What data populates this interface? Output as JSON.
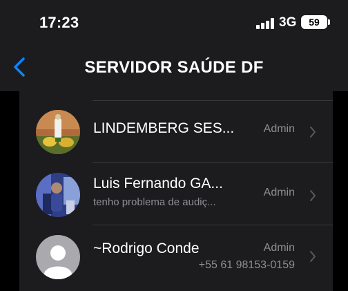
{
  "status": {
    "time": "17:23",
    "network": "3G",
    "battery": "59"
  },
  "nav": {
    "back_icon": "chevron-left-icon",
    "title": "SERVIDOR SAÚDE DF"
  },
  "participants": [
    {
      "name": "LINDEMBERG SES...",
      "subtitle": "",
      "role": "Admin",
      "phone": ""
    },
    {
      "name": "Luis Fernando GA...",
      "subtitle": "tenho problema de audiç...",
      "role": "Admin",
      "phone": ""
    },
    {
      "name": "~Rodrigo Conde",
      "subtitle": "",
      "role": "Admin",
      "phone": "+55 61 98153-0159"
    }
  ],
  "colors": {
    "accent": "#0a84ff",
    "background": "#1c1c1e",
    "secondary_text": "#8e8e93"
  }
}
